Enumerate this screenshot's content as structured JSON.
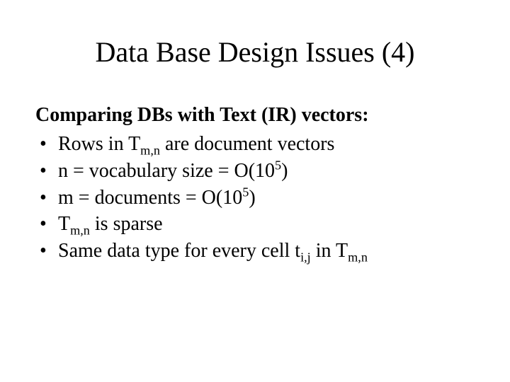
{
  "title": "Data Base Design Issues (4)",
  "heading": "Comparing DBs with Text (IR) vectors:",
  "bullets": [
    {
      "pre": "Rows in T",
      "sub1": "m,n",
      "mid": " are document vectors",
      "sup": "",
      "post": "",
      "sub2": "",
      "tail": ""
    },
    {
      "pre": "n = vocabulary size = O(10",
      "sub1": "",
      "mid": "",
      "sup": "5",
      "post": ")",
      "sub2": "",
      "tail": ""
    },
    {
      "pre": "m = documents = O(10",
      "sub1": "",
      "mid": "",
      "sup": "5",
      "post": ")",
      "sub2": "",
      "tail": ""
    },
    {
      "pre": "T",
      "sub1": "m,n",
      "mid": " is sparse",
      "sup": "",
      "post": "",
      "sub2": "",
      "tail": ""
    },
    {
      "pre": "Same data type for every cell t",
      "sub1": "i,j",
      "mid": " in T",
      "sup": "",
      "post": "",
      "sub2": "m,n",
      "tail": ""
    }
  ]
}
